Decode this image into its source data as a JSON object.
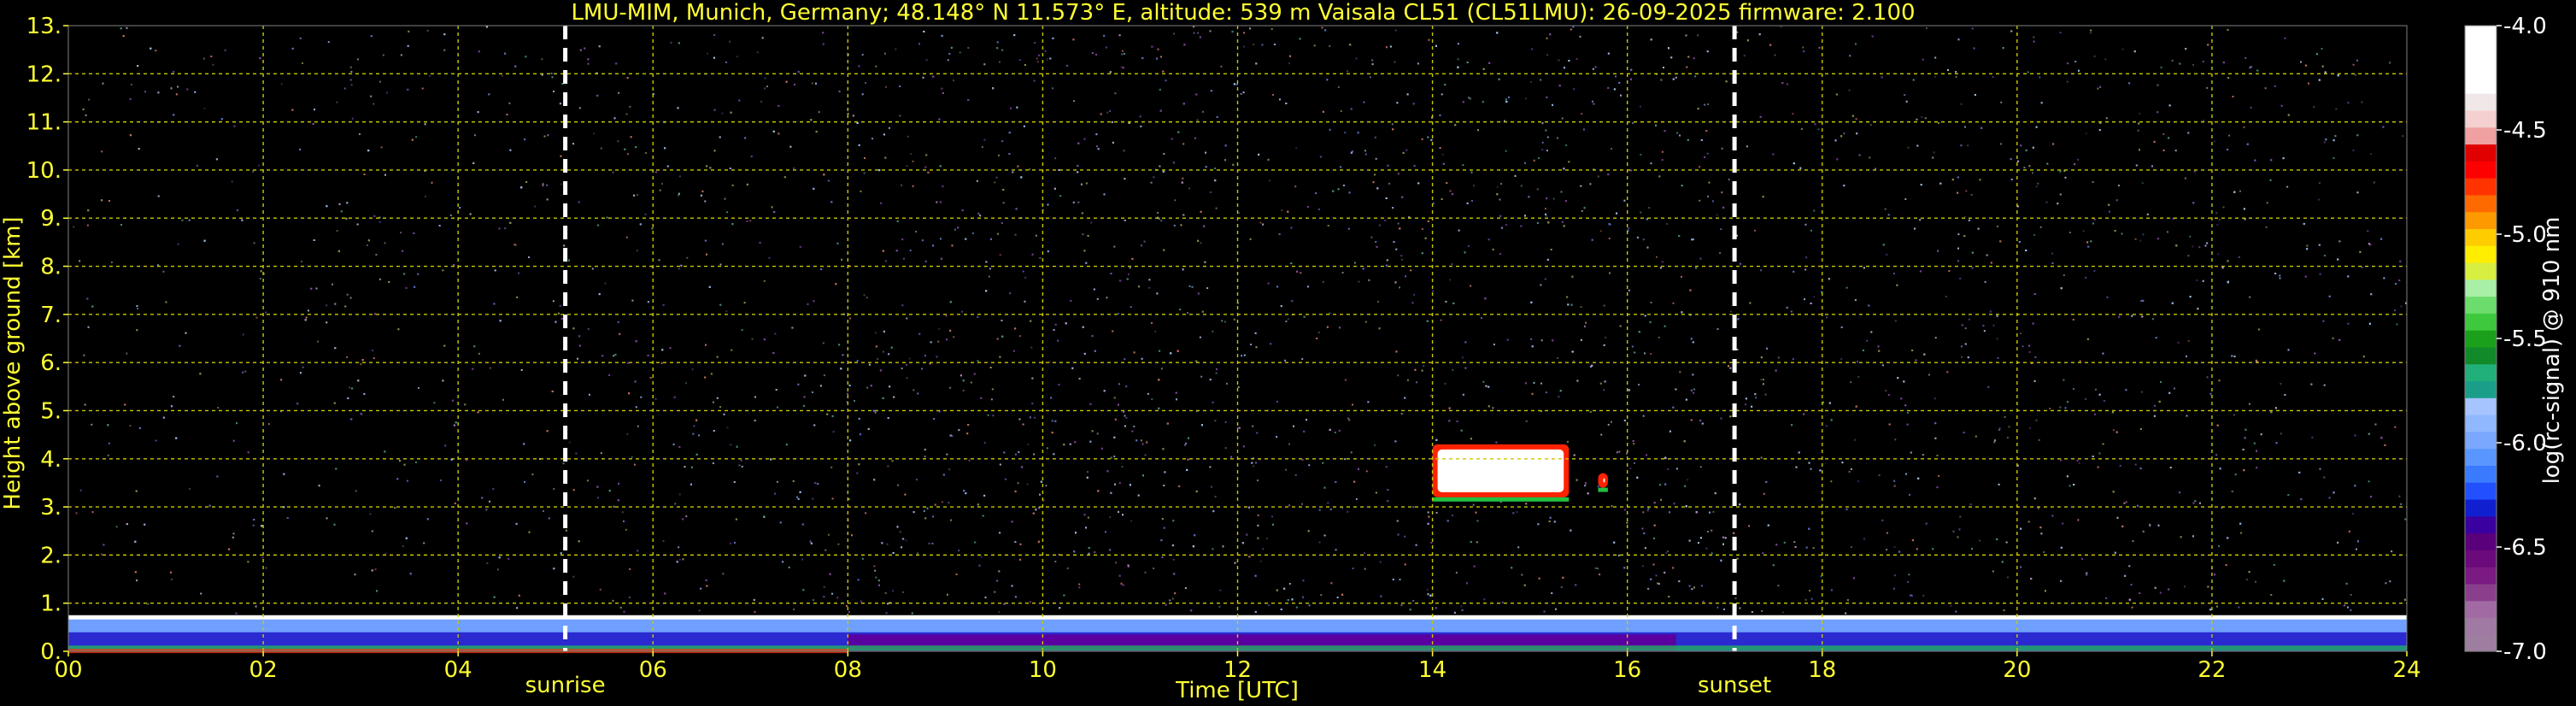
{
  "chart_data": {
    "type": "heatmap",
    "title": "LMU-MIM, Munich, Germany; 48.148° N 11.573° E, altitude: 539 m    Vaisala CL51 (CL51LMU): 26-09-2025    firmware: 2.100",
    "xlabel": "Time [UTC]",
    "ylabel": "Height above ground [km]",
    "xlim": [
      0,
      24
    ],
    "ylim": [
      0,
      13
    ],
    "x_ticks": [
      "00",
      "02",
      "04",
      "06",
      "08",
      "10",
      "12",
      "14",
      "16",
      "18",
      "20",
      "22",
      "24"
    ],
    "y_ticks": [
      "0.",
      "1.",
      "2.",
      "3.",
      "4.",
      "5.",
      "6.",
      "7.",
      "8.",
      "9.",
      "10.",
      "11.",
      "12.",
      "13."
    ],
    "grid": true,
    "markers": [
      {
        "label": "sunrise",
        "time": 5.1
      },
      {
        "label": "sunset",
        "time": 17.1
      }
    ],
    "colorbar": {
      "label": "log(rc-signal) @ 910 nm",
      "range": [
        -7.0,
        -4.0
      ],
      "ticks": [
        "-4.0",
        "-4.5",
        "-5.0",
        "-5.5",
        "-6.0",
        "-6.5",
        "-7.0"
      ],
      "colors": [
        "#9e7ea0",
        "#a07aa3",
        "#a16aa3",
        "#8a3f8c",
        "#7a1a82",
        "#6b0a7a",
        "#5a007a",
        "#3a00a0",
        "#1020d0",
        "#2250ff",
        "#3a7aff",
        "#5a96ff",
        "#7aa8ff",
        "#90b8ff",
        "#a6c4ff",
        "#1a9e8a",
        "#22b07a",
        "#118a2a",
        "#1aa01a",
        "#3ec83e",
        "#6cdc6c",
        "#a8f0a8",
        "#d8ee40",
        "#ffee00",
        "#ffcc00",
        "#ff9900",
        "#ff6a00",
        "#ff3300",
        "#ff0000",
        "#e00000",
        "#f0a0a0",
        "#f5d0d0",
        "#f0e8e8",
        "#ffffff",
        "#ffffff",
        "#ffffff",
        "#ffffff"
      ]
    },
    "features": [
      {
        "name": "boundary layer",
        "start": 0,
        "end": 24,
        "top_km": 0.75
      },
      {
        "name": "cloud",
        "start": 14.0,
        "end": 15.4,
        "base_km": 3.2,
        "top_km": 4.3
      },
      {
        "name": "cloud",
        "start": 15.7,
        "end": 15.8,
        "base_km": 3.4,
        "top_km": 3.7
      }
    ]
  }
}
